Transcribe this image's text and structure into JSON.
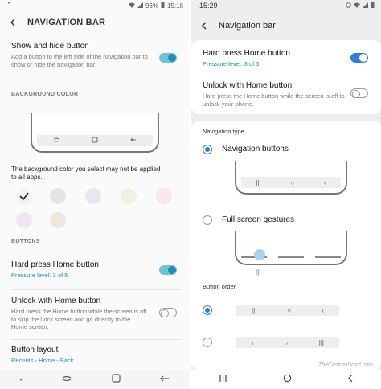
{
  "left": {
    "status": {
      "battery": "96%",
      "time": "15:18"
    },
    "title": "NAVIGATION BAR",
    "show_hide": {
      "title": "Show and hide button",
      "desc": "Add a button to the left side of the navigation bar to show or hide the navigation bar.",
      "enabled": true
    },
    "bg_section": "BACKGROUND COLOR",
    "bg_note": "The background color you select may not be applied to all apps.",
    "swatches": [
      "#f2f2f2",
      "#e4e4e4",
      "#e6e7f3",
      "#f3f0e3",
      "#f7e9ea",
      "#f1e5f1",
      "#efe7dc"
    ],
    "selected_swatch": 0,
    "buttons_section": "BUTTONS",
    "hard_press": {
      "title": "Hard press Home button",
      "pressure": "Pressure level: 3 of 5",
      "enabled": true
    },
    "unlock": {
      "title": "Unlock with Home button",
      "desc": "Hard press the Home button while the screen is off to skip the Lock screen and go directly to the Home screen.",
      "enabled": false
    },
    "layout": {
      "title": "Button layout",
      "value": "Recents - Home - Back"
    }
  },
  "right": {
    "status": {
      "time": "15:29"
    },
    "title": "Navigation bar",
    "hard_press": {
      "title": "Hard press Home button",
      "pressure": "Pressure level: 3 of 5",
      "enabled": true
    },
    "unlock": {
      "title": "Unlock with Home button",
      "desc": "Hard press the Home button while the screen is off to unlock your phone.",
      "enabled": false
    },
    "nav_type_section": "Navigation type",
    "nav_buttons_label": "Navigation buttons",
    "gestures_label": "Full screen gestures",
    "selected_type": "buttons",
    "order_section": "Button order",
    "selected_order": 0,
    "watermark": "TheCustomDroid.com"
  },
  "colors": {
    "accent": "#1a8fa8",
    "toggle_on": "#6fc3d6",
    "samsung_blue": "#2f7de1"
  }
}
